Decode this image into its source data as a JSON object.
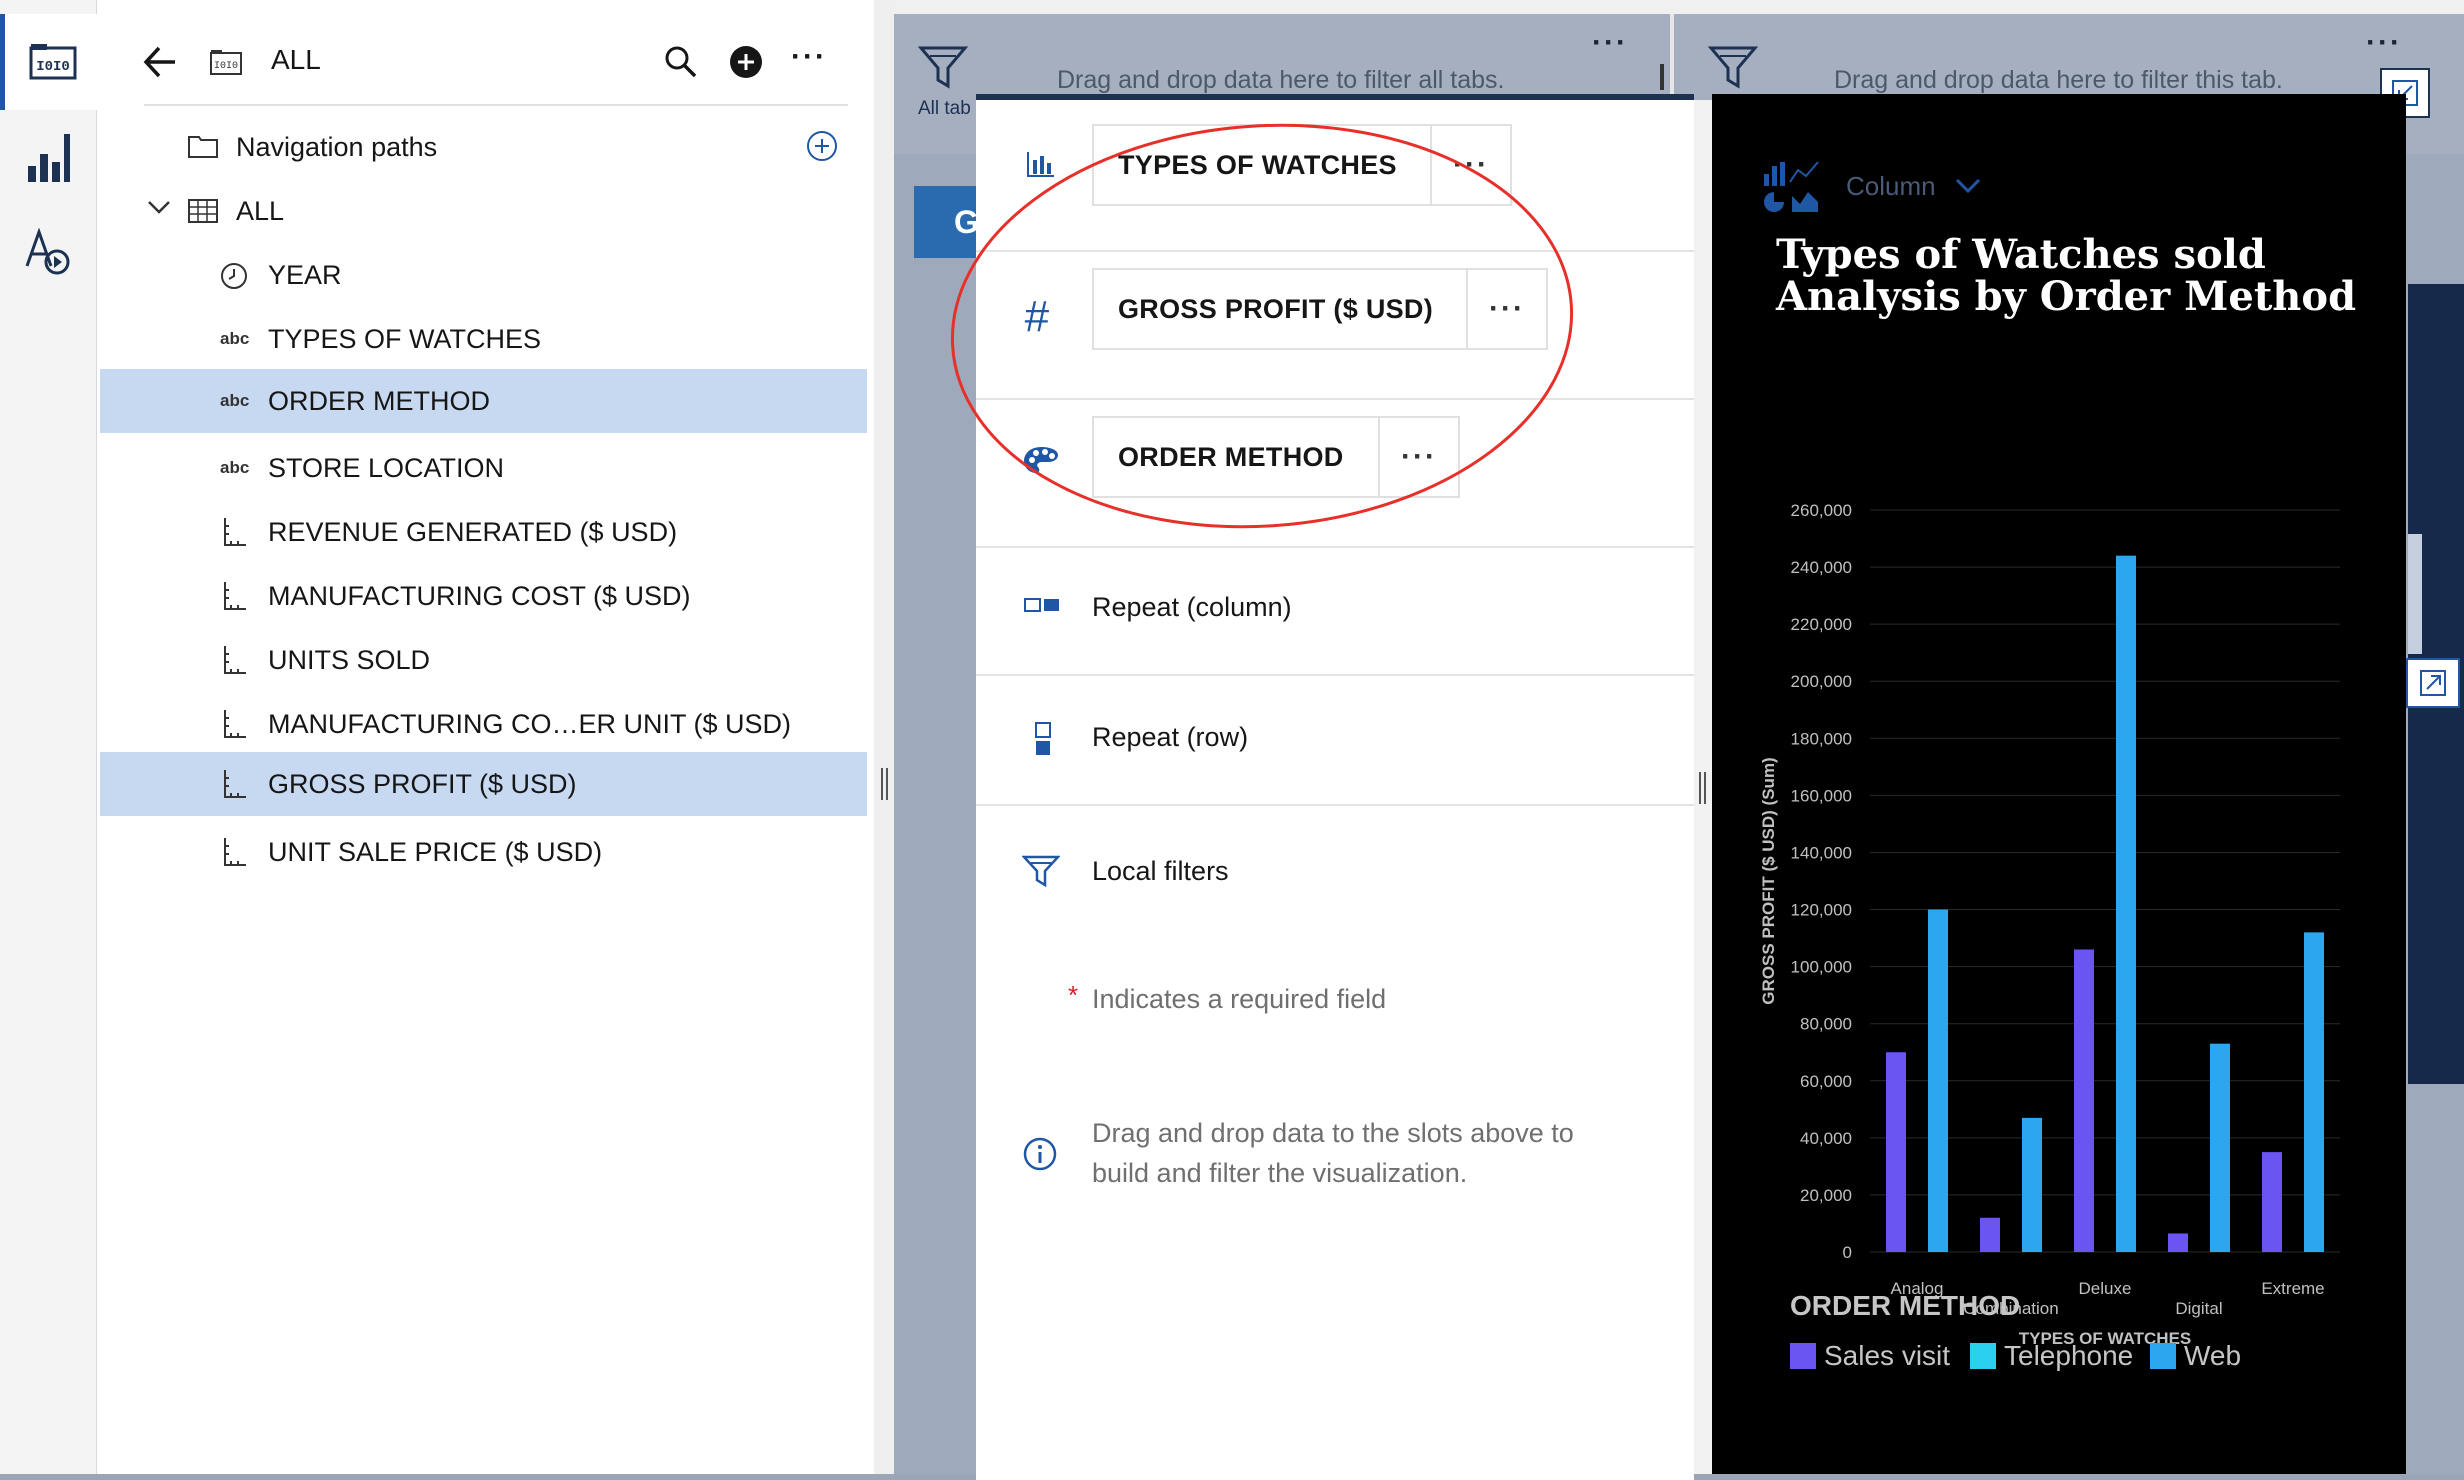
{
  "data_panel": {
    "header_title": "ALL",
    "nav_paths_label": "Navigation paths",
    "tree_root_label": "ALL",
    "items": [
      {
        "type": "date",
        "label": "YEAR"
      },
      {
        "type": "abc",
        "label": "TYPES OF WATCHES"
      },
      {
        "type": "abc",
        "label": "ORDER METHOD"
      },
      {
        "type": "abc",
        "label": "STORE LOCATION"
      },
      {
        "type": "measure",
        "label": "REVENUE GENERATED ($ USD)"
      },
      {
        "type": "measure",
        "label": "MANUFACTURING COST ($ USD)"
      },
      {
        "type": "measure",
        "label": "UNITS SOLD"
      },
      {
        "type": "measure",
        "label": "MANUFACTURING CO…ER UNIT ($ USD)"
      },
      {
        "type": "measure",
        "label": "GROSS PROFIT ($ USD)"
      },
      {
        "type": "measure",
        "label": "UNIT SALE PRICE ($ USD)"
      }
    ],
    "type_abc_label": "abc"
  },
  "dashboard": {
    "filter_all_tabs_text": "Drag and drop data here to filter all tabs.",
    "filter_this_tab_text": "Drag and drop data here to filter this tab.",
    "all_tabs_label": "All tab",
    "tab_button_letter": "G"
  },
  "properties": {
    "slots": [
      {
        "icon": "bar-chart-icon",
        "value": "TYPES OF WATCHES"
      },
      {
        "icon": "hash-icon",
        "value": "GROSS PROFIT ($ USD)"
      },
      {
        "icon": "palette-icon",
        "value": "ORDER METHOD"
      }
    ],
    "more_label": "···",
    "repeat_column_label": "Repeat (column)",
    "repeat_row_label": "Repeat (row)",
    "local_filters_label": "Local filters",
    "required_asterisk": "*",
    "required_note": "Indicates a required field",
    "info_line1": "Drag and drop data to the slots above to",
    "info_line2": "build and filter the visualization."
  },
  "chart_panel": {
    "viz_type_label": "Column",
    "legend_title": "ORDER METHOD"
  },
  "colors": {
    "accent_blue": "#1f57a4",
    "sales_visit": "#6a55f2",
    "telephone": "#2bd0f0",
    "web": "#2aa7ef",
    "annotation_red": "#e8302a"
  },
  "chart_data": {
    "type": "bar",
    "title": "Types of Watches sold Analysis by Order Method",
    "xlabel": "TYPES OF WATCHES",
    "ylabel": "GROSS PROFIT ($ USD) (Sum)",
    "ylim": [
      0,
      260000
    ],
    "yticks": [
      0,
      20000,
      40000,
      60000,
      80000,
      100000,
      120000,
      140000,
      160000,
      180000,
      200000,
      220000,
      240000,
      260000
    ],
    "ytick_labels": [
      "0",
      "20,000",
      "40,000",
      "60,000",
      "80,000",
      "100,000",
      "120,000",
      "140,000",
      "160,000",
      "180,000",
      "200,000",
      "220,000",
      "240,000",
      "260,000"
    ],
    "categories": [
      "Analog",
      "Combination",
      "Deluxe",
      "Digital",
      "Extreme"
    ],
    "series": [
      {
        "name": "Sales visit",
        "color": "#6a55f2",
        "values": [
          70000,
          12000,
          106000,
          6500,
          35000
        ]
      },
      {
        "name": "Telephone",
        "color": "#2bd0f0",
        "values": [
          null,
          null,
          null,
          null,
          null
        ]
      },
      {
        "name": "Web",
        "color": "#2aa7ef",
        "values": [
          120000,
          47000,
          244000,
          73000,
          112000
        ]
      }
    ],
    "legend_position": "bottom",
    "grid": true
  }
}
